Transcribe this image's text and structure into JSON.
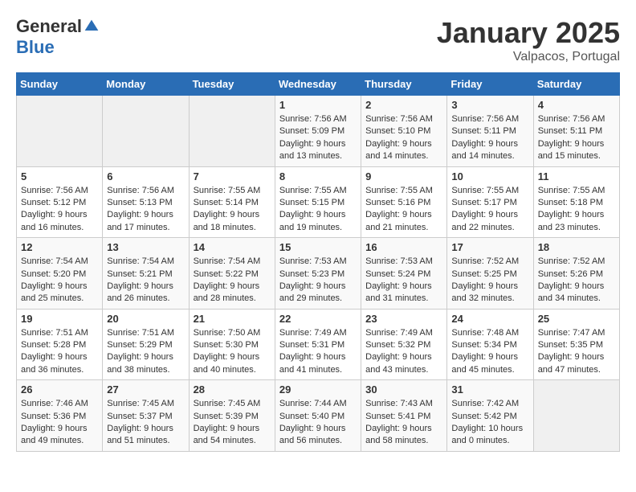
{
  "logo": {
    "general": "General",
    "blue": "Blue"
  },
  "title": "January 2025",
  "subtitle": "Valpacos, Portugal",
  "headers": [
    "Sunday",
    "Monday",
    "Tuesday",
    "Wednesday",
    "Thursday",
    "Friday",
    "Saturday"
  ],
  "weeks": [
    [
      {
        "day": "",
        "sunrise": "",
        "sunset": "",
        "daylight": ""
      },
      {
        "day": "",
        "sunrise": "",
        "sunset": "",
        "daylight": ""
      },
      {
        "day": "",
        "sunrise": "",
        "sunset": "",
        "daylight": ""
      },
      {
        "day": "1",
        "sunrise": "Sunrise: 7:56 AM",
        "sunset": "Sunset: 5:09 PM",
        "daylight": "Daylight: 9 hours and 13 minutes."
      },
      {
        "day": "2",
        "sunrise": "Sunrise: 7:56 AM",
        "sunset": "Sunset: 5:10 PM",
        "daylight": "Daylight: 9 hours and 14 minutes."
      },
      {
        "day": "3",
        "sunrise": "Sunrise: 7:56 AM",
        "sunset": "Sunset: 5:11 PM",
        "daylight": "Daylight: 9 hours and 14 minutes."
      },
      {
        "day": "4",
        "sunrise": "Sunrise: 7:56 AM",
        "sunset": "Sunset: 5:11 PM",
        "daylight": "Daylight: 9 hours and 15 minutes."
      }
    ],
    [
      {
        "day": "5",
        "sunrise": "Sunrise: 7:56 AM",
        "sunset": "Sunset: 5:12 PM",
        "daylight": "Daylight: 9 hours and 16 minutes."
      },
      {
        "day": "6",
        "sunrise": "Sunrise: 7:56 AM",
        "sunset": "Sunset: 5:13 PM",
        "daylight": "Daylight: 9 hours and 17 minutes."
      },
      {
        "day": "7",
        "sunrise": "Sunrise: 7:55 AM",
        "sunset": "Sunset: 5:14 PM",
        "daylight": "Daylight: 9 hours and 18 minutes."
      },
      {
        "day": "8",
        "sunrise": "Sunrise: 7:55 AM",
        "sunset": "Sunset: 5:15 PM",
        "daylight": "Daylight: 9 hours and 19 minutes."
      },
      {
        "day": "9",
        "sunrise": "Sunrise: 7:55 AM",
        "sunset": "Sunset: 5:16 PM",
        "daylight": "Daylight: 9 hours and 21 minutes."
      },
      {
        "day": "10",
        "sunrise": "Sunrise: 7:55 AM",
        "sunset": "Sunset: 5:17 PM",
        "daylight": "Daylight: 9 hours and 22 minutes."
      },
      {
        "day": "11",
        "sunrise": "Sunrise: 7:55 AM",
        "sunset": "Sunset: 5:18 PM",
        "daylight": "Daylight: 9 hours and 23 minutes."
      }
    ],
    [
      {
        "day": "12",
        "sunrise": "Sunrise: 7:54 AM",
        "sunset": "Sunset: 5:20 PM",
        "daylight": "Daylight: 9 hours and 25 minutes."
      },
      {
        "day": "13",
        "sunrise": "Sunrise: 7:54 AM",
        "sunset": "Sunset: 5:21 PM",
        "daylight": "Daylight: 9 hours and 26 minutes."
      },
      {
        "day": "14",
        "sunrise": "Sunrise: 7:54 AM",
        "sunset": "Sunset: 5:22 PM",
        "daylight": "Daylight: 9 hours and 28 minutes."
      },
      {
        "day": "15",
        "sunrise": "Sunrise: 7:53 AM",
        "sunset": "Sunset: 5:23 PM",
        "daylight": "Daylight: 9 hours and 29 minutes."
      },
      {
        "day": "16",
        "sunrise": "Sunrise: 7:53 AM",
        "sunset": "Sunset: 5:24 PM",
        "daylight": "Daylight: 9 hours and 31 minutes."
      },
      {
        "day": "17",
        "sunrise": "Sunrise: 7:52 AM",
        "sunset": "Sunset: 5:25 PM",
        "daylight": "Daylight: 9 hours and 32 minutes."
      },
      {
        "day": "18",
        "sunrise": "Sunrise: 7:52 AM",
        "sunset": "Sunset: 5:26 PM",
        "daylight": "Daylight: 9 hours and 34 minutes."
      }
    ],
    [
      {
        "day": "19",
        "sunrise": "Sunrise: 7:51 AM",
        "sunset": "Sunset: 5:28 PM",
        "daylight": "Daylight: 9 hours and 36 minutes."
      },
      {
        "day": "20",
        "sunrise": "Sunrise: 7:51 AM",
        "sunset": "Sunset: 5:29 PM",
        "daylight": "Daylight: 9 hours and 38 minutes."
      },
      {
        "day": "21",
        "sunrise": "Sunrise: 7:50 AM",
        "sunset": "Sunset: 5:30 PM",
        "daylight": "Daylight: 9 hours and 40 minutes."
      },
      {
        "day": "22",
        "sunrise": "Sunrise: 7:49 AM",
        "sunset": "Sunset: 5:31 PM",
        "daylight": "Daylight: 9 hours and 41 minutes."
      },
      {
        "day": "23",
        "sunrise": "Sunrise: 7:49 AM",
        "sunset": "Sunset: 5:32 PM",
        "daylight": "Daylight: 9 hours and 43 minutes."
      },
      {
        "day": "24",
        "sunrise": "Sunrise: 7:48 AM",
        "sunset": "Sunset: 5:34 PM",
        "daylight": "Daylight: 9 hours and 45 minutes."
      },
      {
        "day": "25",
        "sunrise": "Sunrise: 7:47 AM",
        "sunset": "Sunset: 5:35 PM",
        "daylight": "Daylight: 9 hours and 47 minutes."
      }
    ],
    [
      {
        "day": "26",
        "sunrise": "Sunrise: 7:46 AM",
        "sunset": "Sunset: 5:36 PM",
        "daylight": "Daylight: 9 hours and 49 minutes."
      },
      {
        "day": "27",
        "sunrise": "Sunrise: 7:45 AM",
        "sunset": "Sunset: 5:37 PM",
        "daylight": "Daylight: 9 hours and 51 minutes."
      },
      {
        "day": "28",
        "sunrise": "Sunrise: 7:45 AM",
        "sunset": "Sunset: 5:39 PM",
        "daylight": "Daylight: 9 hours and 54 minutes."
      },
      {
        "day": "29",
        "sunrise": "Sunrise: 7:44 AM",
        "sunset": "Sunset: 5:40 PM",
        "daylight": "Daylight: 9 hours and 56 minutes."
      },
      {
        "day": "30",
        "sunrise": "Sunrise: 7:43 AM",
        "sunset": "Sunset: 5:41 PM",
        "daylight": "Daylight: 9 hours and 58 minutes."
      },
      {
        "day": "31",
        "sunrise": "Sunrise: 7:42 AM",
        "sunset": "Sunset: 5:42 PM",
        "daylight": "Daylight: 10 hours and 0 minutes."
      },
      {
        "day": "",
        "sunrise": "",
        "sunset": "",
        "daylight": ""
      }
    ]
  ]
}
